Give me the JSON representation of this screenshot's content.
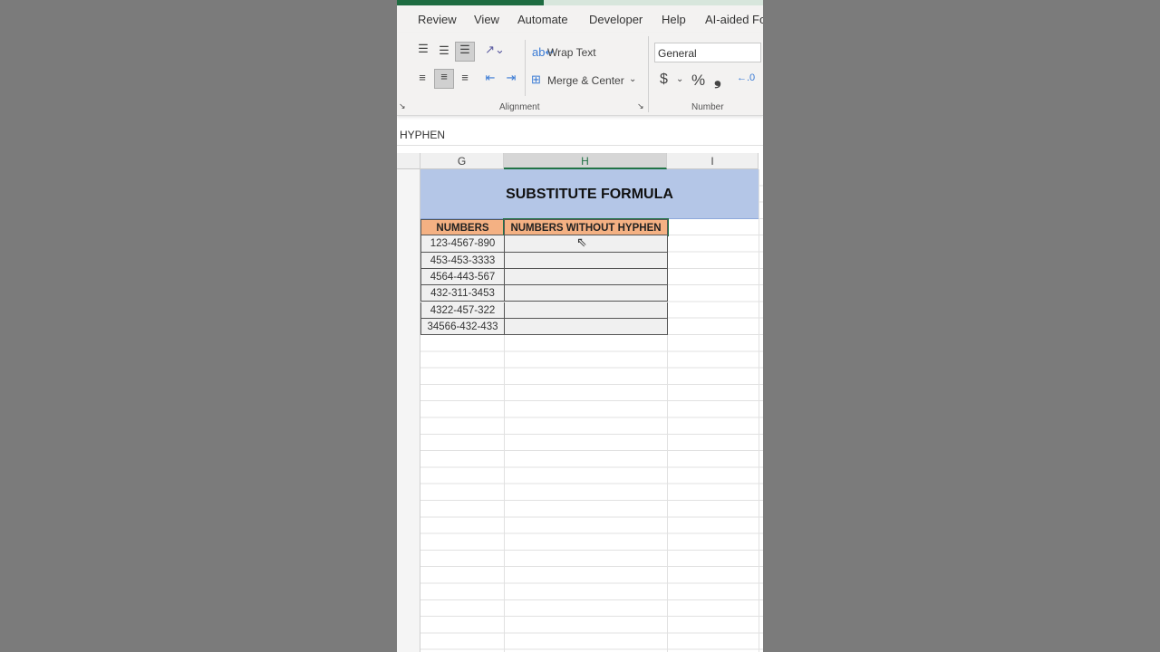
{
  "ribbon": {
    "tabs": [
      "Review",
      "View",
      "Automate",
      "Developer",
      "Help",
      "AI-aided Fo"
    ],
    "wrap_text": "Wrap Text",
    "merge_center": "Merge & Center",
    "alignment_label": "Alignment",
    "number_format": "General",
    "number_label": "Number",
    "currency": "$",
    "percent": "%",
    "comma": "❟"
  },
  "formula_bar": {
    "value": "HYPHEN"
  },
  "columns": [
    "G",
    "H",
    "I"
  ],
  "sheet": {
    "title": "SUBSTITUTE FORMULA",
    "headers": [
      "NUMBERS",
      "NUMBERS WITHOUT HYPHEN"
    ],
    "rows": [
      "123-4567-890",
      "453-453-3333",
      "4564-443-567",
      "432-311-3453",
      "4322-457-322",
      "34566-432-433"
    ]
  },
  "colors": {
    "accent": "#217346",
    "title_fill": "#b4c6e7",
    "header_fill": "#f4b183"
  }
}
